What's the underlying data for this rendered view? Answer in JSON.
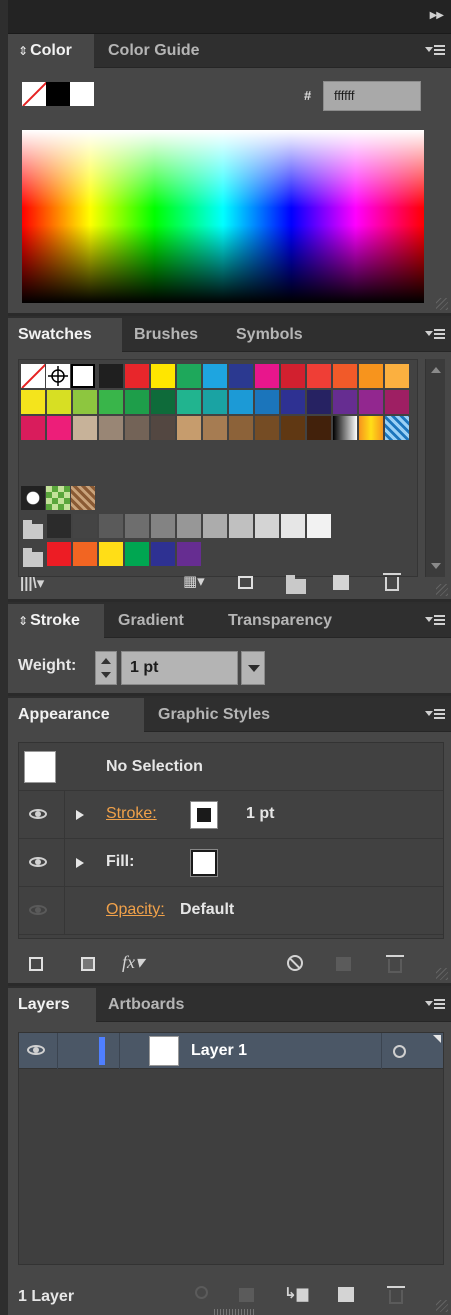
{
  "color_panel": {
    "tabs": [
      "Color",
      "Color Guide"
    ],
    "hash_label": "#",
    "hex_value": "ffffff"
  },
  "swatches_panel": {
    "tabs": [
      "Swatches",
      "Brushes",
      "Symbols"
    ],
    "row1": [
      "#1f1f1f",
      "#e8262b",
      "#ffe600",
      "#1ea85b",
      "#1ea5e0",
      "#2b3990",
      "#e8168c",
      "#d2202f",
      "#ef3e36",
      "#f15a29",
      "#f7941d",
      "#fbb040"
    ],
    "row2": [
      "#f4e41c",
      "#d7df23",
      "#8dc63f",
      "#39b54a",
      "#1e9e4a",
      "#0e6b3a",
      "#21b48f",
      "#1aa3a3",
      "#1c9ad6",
      "#1b75bb",
      "#2e3192",
      "#262262",
      "#662d91",
      "#92278f",
      "#9e1f63"
    ],
    "row3": [
      "#d91c5c",
      "#ed1e79",
      "#c7b299",
      "#998675",
      "#736357",
      "#534741",
      "#c69c6d",
      "#a67c52",
      "#8c6239",
      "#754c24",
      "#603813",
      "#42210b"
    ],
    "gray_row": [
      "#2b2b2b",
      "#444444",
      "#5a5a5a",
      "#6e6e6e",
      "#838383",
      "#979797",
      "#acacac",
      "#c0c0c0",
      "#d4d4d4",
      "#e6e6e6",
      "#f2f2f2"
    ],
    "color_group": [
      "#ed1c24",
      "#f26522",
      "#ffde17",
      "#00a651",
      "#2e3192",
      "#662d91"
    ]
  },
  "stroke_panel": {
    "tabs": [
      "Stroke",
      "Gradient",
      "Transparency"
    ],
    "weight_label": "Weight:",
    "weight_value": "1 pt"
  },
  "appearance_panel": {
    "tabs": [
      "Appearance",
      "Graphic Styles"
    ],
    "selection": "No Selection",
    "stroke_label": "Stroke:",
    "stroke_value": "1 pt",
    "fill_label": "Fill:",
    "opacity_label": "Opacity:",
    "opacity_value": "Default",
    "fx_label": "fx"
  },
  "layers_panel": {
    "tabs": [
      "Layers",
      "Artboards"
    ],
    "layer_name": "Layer 1",
    "layer_color": "#4f7fff",
    "count_label": "1 Layer"
  },
  "icons": [
    "collapse-icon",
    "panel-menu-icon",
    "eye-icon",
    "trash-icon",
    "folder-icon",
    "new-swatch-icon",
    "search-icon"
  ]
}
